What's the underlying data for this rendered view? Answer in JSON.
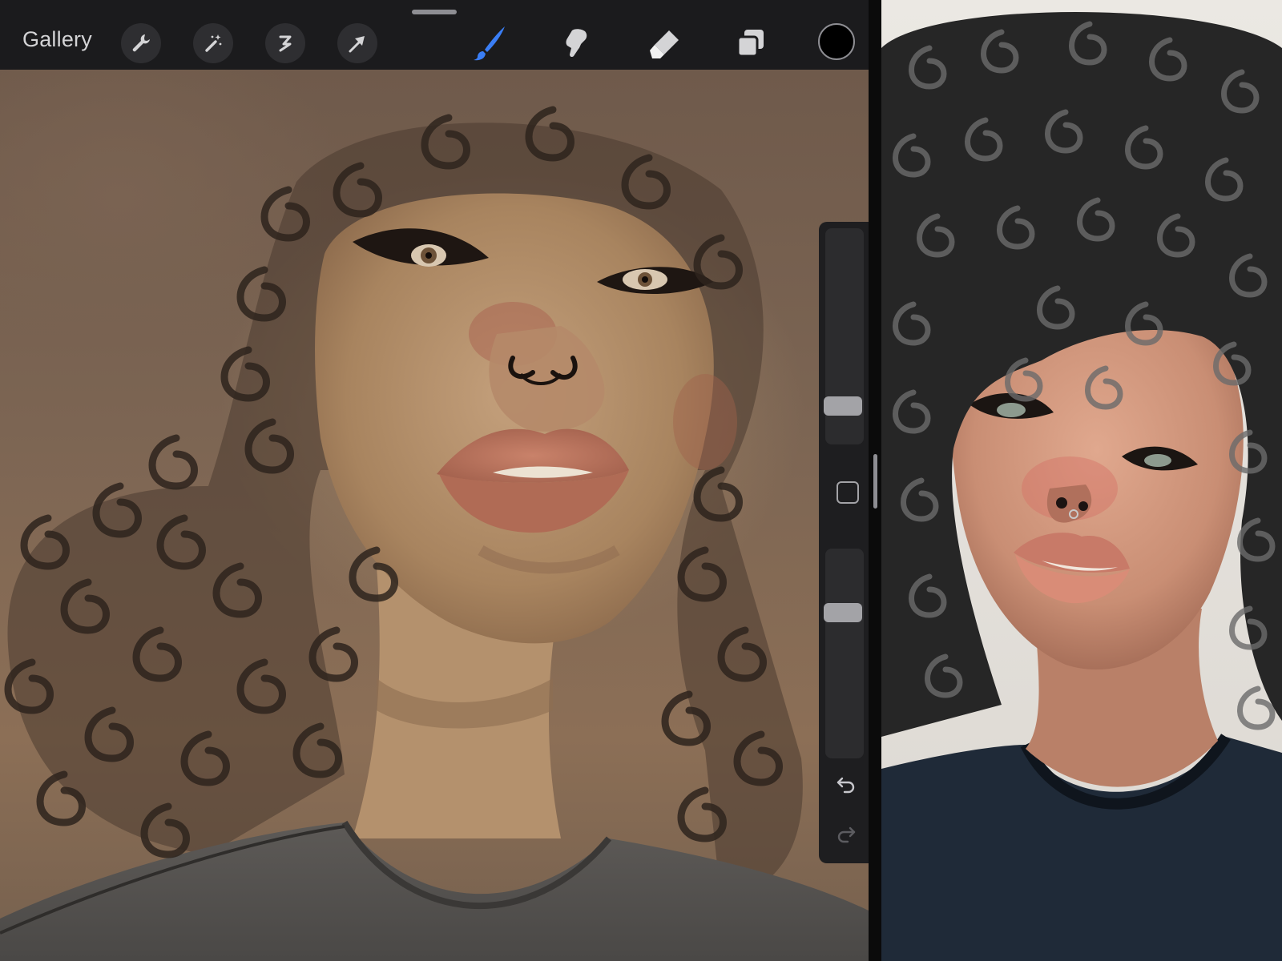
{
  "toolbar": {
    "gallery_label": "Gallery",
    "tools": [
      {
        "name": "wrench-icon",
        "role": "actions"
      },
      {
        "name": "magic-wand-icon",
        "role": "adjustments"
      },
      {
        "name": "selection-icon",
        "role": "selection"
      },
      {
        "name": "transform-arrow-icon",
        "role": "transform"
      },
      {
        "name": "brush-icon",
        "role": "paint",
        "active": true
      },
      {
        "name": "smudge-icon",
        "role": "smudge"
      },
      {
        "name": "eraser-icon",
        "role": "erase"
      },
      {
        "name": "layers-icon",
        "role": "layers"
      }
    ],
    "active_tool": "brush",
    "current_color": "#000000"
  },
  "sidebar": {
    "brush_size_level": 0.72,
    "opacity_level": 0.3,
    "icons": [
      "modify-button",
      "undo-arrow-icon",
      "redo-arrow-icon"
    ]
  },
  "colors": {
    "toolbar_bg": "#1b1b1d",
    "tool_circle_bg": "#2e2e31",
    "active_tool_accent": "#3a7ef5",
    "icon_color": "#d4d4d6"
  }
}
